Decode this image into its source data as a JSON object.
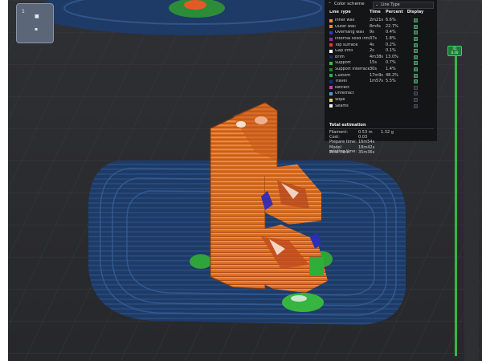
{
  "viewport": {
    "nav_cube": {
      "top_label": "1",
      "face_a": "■",
      "face_b": "▪"
    }
  },
  "legend": {
    "header_icon": "collapse-arrow-icon",
    "color_scheme_label": "Color scheme",
    "color_scheme_value": "Line Type",
    "columns": {
      "type": "Line Type",
      "time": "Time",
      "percent": "Percent",
      "display": "Display"
    },
    "rows": [
      {
        "name": "Inner wall",
        "time": "2m21s",
        "percent": "6.6%",
        "color": "#e89c2a",
        "shown": true
      },
      {
        "name": "Outer wall",
        "time": "8m4s",
        "percent": "22.7%",
        "color": "#ef8a1e",
        "shown": true
      },
      {
        "name": "Overhang wall",
        "time": "9s",
        "percent": "0.4%",
        "color": "#2d3bd0",
        "shown": true
      },
      {
        "name": "Internal solid infill",
        "time": "37s",
        "percent": "1.8%",
        "color": "#a1289e",
        "shown": true
      },
      {
        "name": "Top surface",
        "time": "4s",
        "percent": "0.2%",
        "color": "#e23b3b",
        "shown": true
      },
      {
        "name": "Gap infill",
        "time": "2s",
        "percent": "0.1%",
        "color": "#ffffff",
        "shown": true
      },
      {
        "name": "Brim",
        "time": "4m38s",
        "percent": "13.0%",
        "color": "#1a2e52",
        "shown": true
      },
      {
        "name": "Support",
        "time": "15s",
        "percent": "0.7%",
        "color": "#38c23a",
        "shown": true
      },
      {
        "name": "Support interface",
        "time": "30s",
        "percent": "1.4%",
        "color": "#2a7a2a",
        "shown": true
      },
      {
        "name": "Custom",
        "time": "17m9s",
        "percent": "48.2%",
        "color": "#2fb04a",
        "shown": true
      },
      {
        "name": "Travel",
        "time": "1m57s",
        "percent": "5.5%",
        "color": "#1a2a8a",
        "shown": true
      },
      {
        "name": "Retract",
        "time": "",
        "percent": "",
        "color": "#c040c0",
        "shown": false
      },
      {
        "name": "Unretract",
        "time": "",
        "percent": "",
        "color": "#4aa3d8",
        "shown": false
      },
      {
        "name": "Wipe",
        "time": "",
        "percent": "",
        "color": "#f0d23a",
        "shown": false
      },
      {
        "name": "Seams",
        "time": "",
        "percent": "",
        "color": "#f0f0f0",
        "shown": false
      }
    ],
    "totals": {
      "title": "Total estimation",
      "items": [
        {
          "k": "Filament:",
          "v": "0.53 m",
          "v2": "1.32 g"
        },
        {
          "k": "Cost:",
          "v": "0.03",
          "v2": ""
        },
        {
          "k": "Prepare time:",
          "v": "16m54s",
          "v2": ""
        },
        {
          "k": "Model printing time:",
          "v": "18m42s",
          "v2": ""
        },
        {
          "k": "Total time:",
          "v": "35m36s",
          "v2": ""
        }
      ]
    }
  },
  "layer_slider": {
    "top_value": "41",
    "top_height": "8.40"
  }
}
